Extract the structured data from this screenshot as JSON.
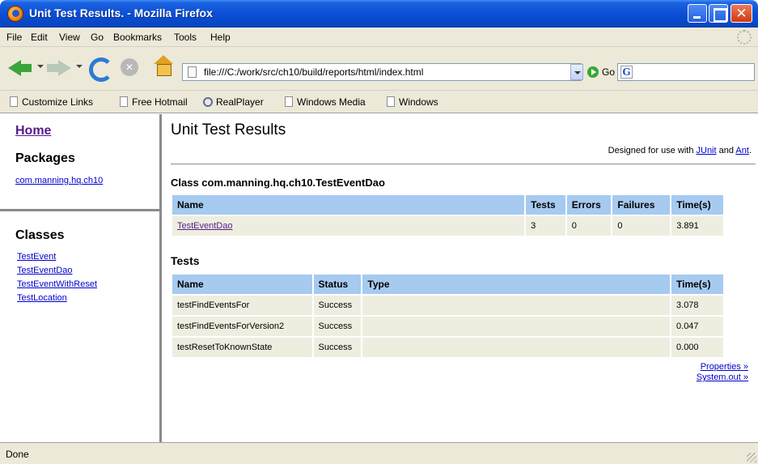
{
  "window": {
    "title": "Unit Test Results. - Mozilla Firefox"
  },
  "menu": [
    "File",
    "Edit",
    "View",
    "Go",
    "Bookmarks",
    "Tools",
    "Help"
  ],
  "nav": {
    "url": "file:///C:/work/src/ch10/build/reports/html/index.html",
    "go_label": "Go",
    "search_value": ""
  },
  "links_toolbar": [
    "Customize Links",
    "Free Hotmail",
    "RealPlayer",
    "Windows Media",
    "Windows"
  ],
  "sidebar": {
    "home_label": "Home",
    "packages_heading": "Packages",
    "packages": [
      "com.manning.hq.ch10"
    ],
    "classes_heading": "Classes",
    "classes": [
      "TestEvent",
      "TestEventDao",
      "TestEventWithReset",
      "TestLocation"
    ]
  },
  "main": {
    "title": "Unit Test Results",
    "designed_prefix": "Designed for use with ",
    "junit_link": "JUnit",
    "designed_and": " and ",
    "ant_link": "Ant",
    "designed_suffix": ".",
    "class_heading": "Class com.manning.hq.ch10.TestEventDao",
    "summary_headers": [
      "Name",
      "Tests",
      "Errors",
      "Failures",
      "Time(s)"
    ],
    "summary_row": {
      "name": "TestEventDao",
      "tests": "3",
      "errors": "0",
      "failures": "0",
      "time": "3.891"
    },
    "tests_heading": "Tests",
    "tests_headers": [
      "Name",
      "Status",
      "Type",
      "Time(s)"
    ],
    "tests": [
      {
        "name": "testFindEventsFor",
        "status": "Success",
        "type": "",
        "time": "3.078"
      },
      {
        "name": "testFindEventsForVersion2",
        "status": "Success",
        "type": "",
        "time": "0.047"
      },
      {
        "name": "testResetToKnownState",
        "status": "Success",
        "type": "",
        "time": "0.000"
      }
    ],
    "properties_link": "Properties »",
    "system_out_link": "System.out »"
  },
  "status": {
    "text": "Done"
  }
}
